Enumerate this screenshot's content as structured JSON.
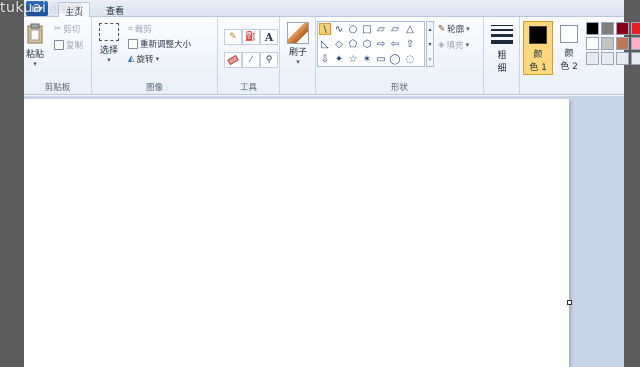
{
  "watermark": "tukuai.com",
  "tabs": {
    "app_menu": "▾",
    "home": "主页",
    "view": "查看"
  },
  "clipboard": {
    "group_label": "剪贴板",
    "paste": "粘贴",
    "cut": "剪切",
    "copy": "复制"
  },
  "image": {
    "group_label": "图像",
    "select": "选择",
    "crop": "裁剪",
    "resize": "重新调整大小",
    "rotate": "旋转"
  },
  "tools": {
    "group_label": "工具",
    "text_tool": "A"
  },
  "brushes": {
    "label": "刷子"
  },
  "shapes": {
    "group_label": "形状",
    "outline": "轮廓",
    "fill": "填充",
    "glyphs": [
      "\\",
      "∿",
      "○",
      "□",
      "▱",
      "△",
      "◺",
      "◇",
      "⬠",
      "⬡",
      "⇨",
      "⇦",
      "⇧",
      "⇩",
      "✦",
      "☆",
      "✶",
      "▭",
      "◯",
      "◌"
    ]
  },
  "size": {
    "label_line1": "粗",
    "label_line2": "细"
  },
  "colors": {
    "color1_line1": "颜",
    "color1_line2": "色 1",
    "color2_line1": "颜",
    "color2_line2": "色 2",
    "color1_value": "#000000",
    "color2_value": "#ffffff",
    "palette": [
      "#000000",
      "#7f7f7f",
      "#880015",
      "#ed1c24",
      "#ffffff",
      "#c3c3c3",
      "#b97a57",
      "#ffaec9",
      "#e6ebf2",
      "#e6ebf2",
      "#e6ebf2",
      "#e6ebf2"
    ]
  }
}
